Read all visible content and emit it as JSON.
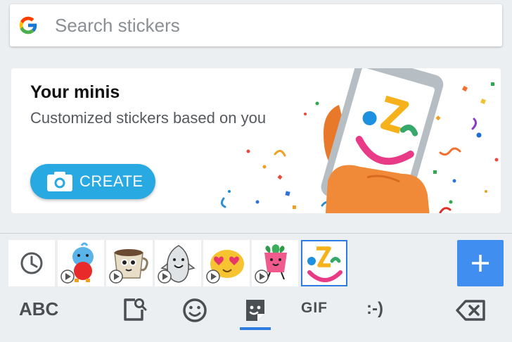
{
  "search": {
    "placeholder": "Search stickers",
    "icon": "google-g-icon"
  },
  "promo": {
    "title": "Your minis",
    "subtitle": "Customized stickers based on you",
    "button_label": "CREATE",
    "button_icon": "camera-icon",
    "accent_color": "#29a9e1"
  },
  "tray": {
    "items": [
      {
        "name": "recent-stickers",
        "icon": "clock-icon",
        "selected": false
      },
      {
        "name": "blue-bird-pack",
        "animated": true,
        "selected": false
      },
      {
        "name": "coffee-cup-pack",
        "animated": true,
        "selected": false
      },
      {
        "name": "shark-pack",
        "animated": true,
        "selected": false
      },
      {
        "name": "heart-eyes-blob-pack",
        "animated": true,
        "selected": false
      },
      {
        "name": "cactus-pot-pack",
        "animated": true,
        "selected": false
      },
      {
        "name": "minis-face-pack",
        "animated": false,
        "selected": true
      }
    ],
    "add_icon": "plus-icon",
    "selected_color": "#2e7be2"
  },
  "bottom_bar": {
    "abc_label": "ABC",
    "gif_label": "GIF",
    "emoticon_label": ":-)",
    "icons": [
      "sticker-search-icon",
      "emoji-icon",
      "sticker-icon",
      "backspace-icon"
    ],
    "active_tab": "sticker-icon"
  }
}
